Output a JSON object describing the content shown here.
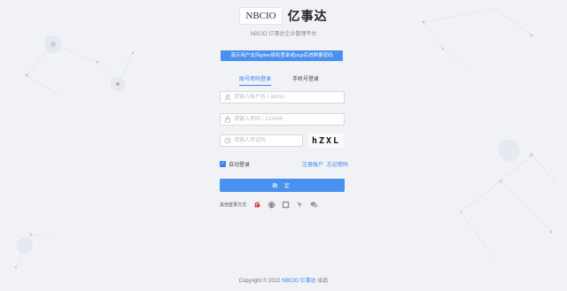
{
  "header": {
    "logo_text": "NBCIO",
    "app_name": "亿事达",
    "description": "NBCIO 亿事达企业管理平台"
  },
  "notice": {
    "text": "演示用户支持gitee授权登录或sicp后进群要密码"
  },
  "tabs": [
    {
      "label": "账号密码登录",
      "active": true
    },
    {
      "label": "手机号登录",
      "active": false
    }
  ],
  "form": {
    "username_placeholder": "请输入帐户名 / admin",
    "password_placeholder": "请输入密码 / 123456",
    "captcha_placeholder": "请输入验证码",
    "captcha_text": "hZXL",
    "remember_label": "自动登录",
    "remember_checked": true,
    "register_link": "注册账户",
    "forgot_link": "忘记密码",
    "submit_label": "确 定"
  },
  "other_login": {
    "label": "其他登录方式",
    "icons": [
      "gitee-icon",
      "github-icon",
      "qq-icon",
      "weibo-icon",
      "wechat-icon"
    ]
  },
  "footer": {
    "prefix": "Copyright © 2022",
    "brand": "NBCIO 亿事达",
    "suffix": "出品"
  },
  "colors": {
    "primary": "#4a90f0",
    "link": "#3b82f6",
    "background": "#f0f2f5",
    "gitee": "#c71d23"
  }
}
